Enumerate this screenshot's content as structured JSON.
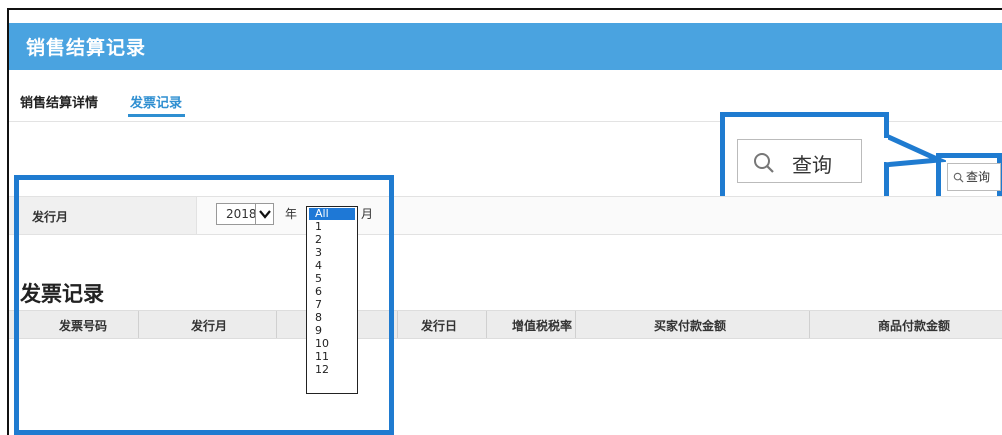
{
  "header": {
    "title": "销售结算记录"
  },
  "tabs": [
    {
      "label": "销售结算详情"
    },
    {
      "label": "发票记录"
    }
  ],
  "filter": {
    "label": "发行月",
    "year_value": "2018",
    "year_unit": "年",
    "month_unit": "月",
    "month_options": [
      "All",
      "1",
      "2",
      "3",
      "4",
      "5",
      "6",
      "7",
      "8",
      "9",
      "10",
      "11",
      "12"
    ],
    "month_selected": "All"
  },
  "query_button": {
    "label": "查询"
  },
  "section": {
    "title": "发票记录"
  },
  "table": {
    "headers": [
      "发票号码",
      "发行月",
      "",
      "发行日",
      "增值税税率",
      "买家付款金额",
      "商品付款金额"
    ],
    "rows": []
  },
  "colors": {
    "header_bg": "#4aa3e0",
    "accent": "#2f8fd1",
    "highlight": "#1f7bd0"
  }
}
